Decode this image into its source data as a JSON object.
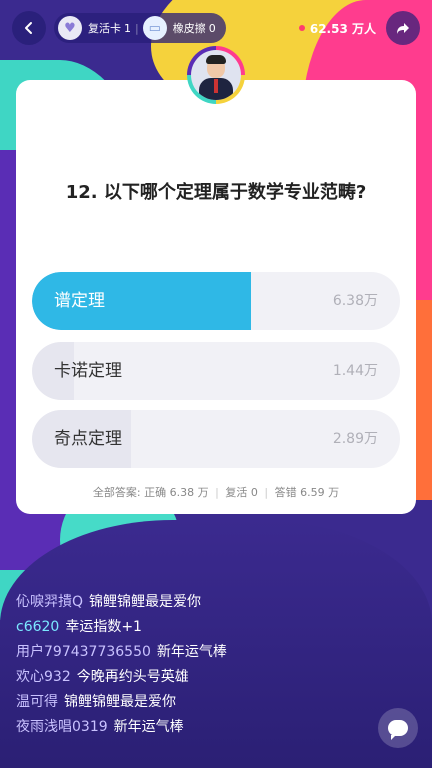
{
  "topbar": {
    "revive_card_label": "复活卡",
    "revive_card_count": "1",
    "eraser_label": "橡皮擦",
    "eraser_count": "0",
    "viewers": "62.53 万人"
  },
  "question": {
    "number": "12.",
    "text": "以下哪个定理属于数学专业范畴?"
  },
  "options": [
    {
      "label": "谱定理",
      "count": "6.38万",
      "correct": true,
      "share": 0.595
    },
    {
      "label": "卡诺定理",
      "count": "1.44万",
      "correct": false,
      "share": 0.114
    },
    {
      "label": "奇点定理",
      "count": "2.89万",
      "correct": false,
      "share": 0.269
    }
  ],
  "summary": {
    "prefix": "全部答案:",
    "correct": "正确 6.38 万",
    "revive": "复活 0",
    "wrong": "答错 6.59 万"
  },
  "chat": [
    {
      "user": "伈唳羿撌Q",
      "message": "锦鲤锦鲤最是爱你"
    },
    {
      "user": "c6620",
      "message": "幸运指数+1"
    },
    {
      "user": "用户797437736550",
      "message": "新年运气棒"
    },
    {
      "user": "欢心932",
      "message": "今晚再约头号英雄"
    },
    {
      "user": "温可得",
      "message": "锦鲤锦鲤最是爱你"
    },
    {
      "user": "夜雨浅唱0319",
      "message": "新年运气棒"
    }
  ],
  "icons": {
    "back": "back-arrow-icon",
    "revive": "heart-icon",
    "eraser": "eraser-icon",
    "share": "share-icon",
    "chat": "chat-bubble-icon"
  },
  "colors": {
    "correct_fill": "#2fb8e6",
    "option_bg": "#f1f1f6",
    "background": "#3b2a8f"
  }
}
